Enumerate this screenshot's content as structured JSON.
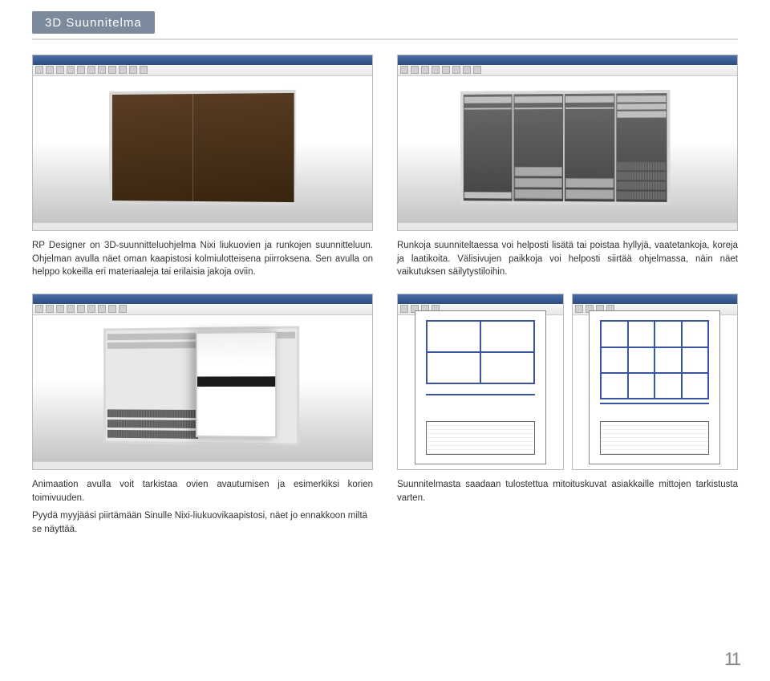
{
  "page": {
    "title": "3D Suunnitelma",
    "number": "11"
  },
  "captions": {
    "r1c1": "RP Designer on 3D-suunnitteluohjelma Nixi liukuovien ja runkojen suunnitteluun. Ohjelman avulla näet oman kaapistosi kolmiulotteisena piirroksena. Sen avulla on helppo kokeilla eri materiaaleja tai erilaisia jakoja oviin.",
    "r1c2": "Runkoja suunniteltaessa voi helposti lisätä tai poistaa hyllyjä, vaatetankoja, koreja ja laatikoita. Välisivujen paikkoja voi helposti siirtää ohjelmassa, näin näet vaikutuksen säilytystiloihin.",
    "r2c1": "Animaation avulla voit tarkistaa ovien avautumisen ja esimerkiksi korien toimivuuden.",
    "r2c2": "Suunnitelmasta saadaan tulostettua mitoituskuvat asiakkaille mittojen tarkistusta varten.",
    "footer": "Pyydä myyjääsi piirtämään Sinulle Nixi-liukuovikaapistosi, näet jo ennakkoon miltä se näyttää."
  }
}
